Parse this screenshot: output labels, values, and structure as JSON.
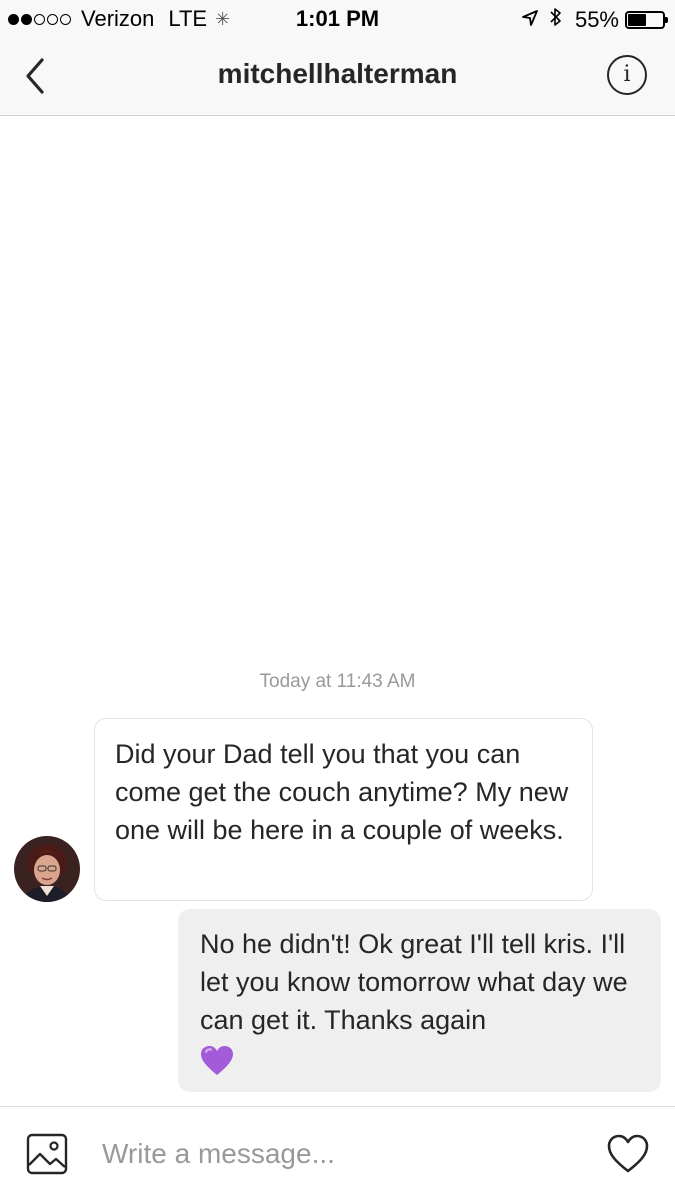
{
  "status_bar": {
    "carrier": "Verizon",
    "network": "LTE",
    "time": "1:01 PM",
    "battery_percent": "55%",
    "battery_level": 0.55,
    "signal_bars_filled": 2,
    "signal_bars_total": 5
  },
  "header": {
    "title": "mitchellhalterman",
    "info_icon": "info-icon",
    "back_icon": "chevron-left-icon"
  },
  "conversation": {
    "timestamp": "Today at 11:43 AM",
    "messages": [
      {
        "direction": "incoming",
        "text": "Did your Dad tell you that you can come get the couch anytime?  My new one will be here in a couple of weeks."
      },
      {
        "direction": "outgoing",
        "text": "No he didn't! Ok great I'll tell kris. I'll let you know tomorrow what day we can get it. Thanks again",
        "emoji": "purple-heart"
      }
    ]
  },
  "composer": {
    "placeholder": "Write a message...",
    "gallery_icon": "image-icon",
    "like_icon": "heart-icon"
  },
  "colors": {
    "accent_purple": "#a35bd9",
    "bubble_outgoing": "#efefef",
    "text": "#262626",
    "muted": "#999999"
  }
}
